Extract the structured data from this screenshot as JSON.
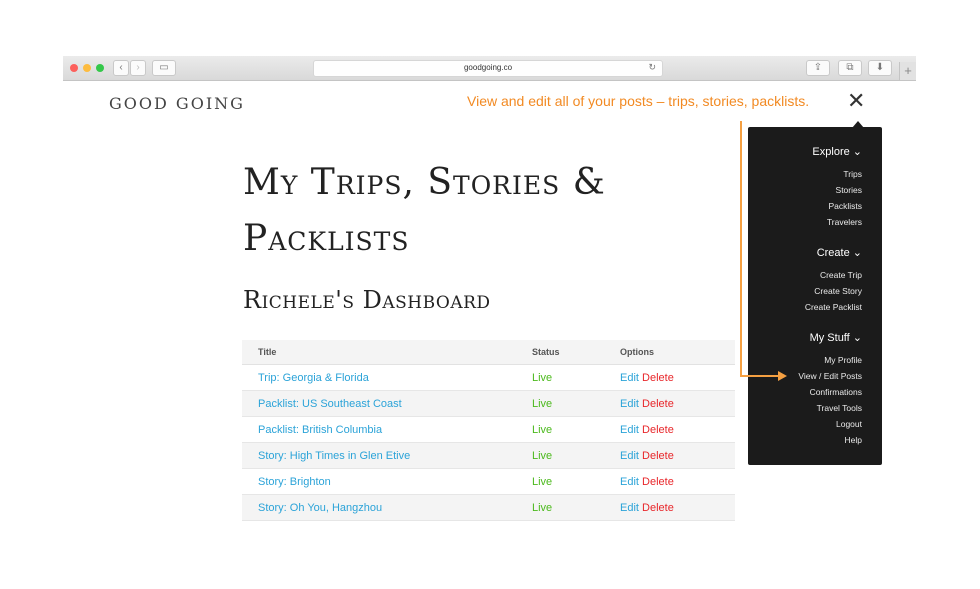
{
  "browser": {
    "url": "goodgoing.co",
    "plus_label": "+"
  },
  "site": {
    "brand": "GOOD GOING",
    "annotation": "View and edit all of your posts – trips, stories, packlists.",
    "close_glyph": "✕"
  },
  "page": {
    "title": "My Trips, Stories & Packlists",
    "dashboard_title": "Richele's Dashboard"
  },
  "table": {
    "headers": [
      "Title",
      "Status",
      "Options"
    ],
    "edit_label": "Edit",
    "delete_label": "Delete",
    "rows": [
      {
        "title": "Trip: Georgia & Florida",
        "status": "Live"
      },
      {
        "title": "Packlist: US Southeast Coast",
        "status": "Live"
      },
      {
        "title": "Packlist: British Columbia",
        "status": "Live"
      },
      {
        "title": "Story: High Times in Glen Etive",
        "status": "Live"
      },
      {
        "title": "Story: Brighton",
        "status": "Live"
      },
      {
        "title": "Story: Oh You, Hangzhou",
        "status": "Live"
      }
    ]
  },
  "menu": {
    "explore": {
      "label": "Explore ⌄",
      "items": [
        "Trips",
        "Stories",
        "Packlists",
        "Travelers"
      ]
    },
    "create": {
      "label": "Create ⌄",
      "items": [
        "Create Trip",
        "Create Story",
        "Create Packlist"
      ]
    },
    "mystuff": {
      "label": "My Stuff ⌄",
      "items": [
        "My Profile",
        "View / Edit Posts",
        "Confirmations",
        "Travel Tools",
        "Logout",
        "Help"
      ]
    }
  },
  "icons": {
    "back": "back-icon",
    "forward": "forward-icon",
    "sidebar": "sidebar-icon",
    "reload": "reload-icon",
    "share": "share-icon",
    "tabs": "tabs-icon",
    "download": "download-icon"
  },
  "colors": {
    "accent_link": "#2ba3d8",
    "status_live": "#4bb91c",
    "delete": "#e8262a",
    "annotation": "#f28a23",
    "menu_bg": "#1b1b1b"
  }
}
